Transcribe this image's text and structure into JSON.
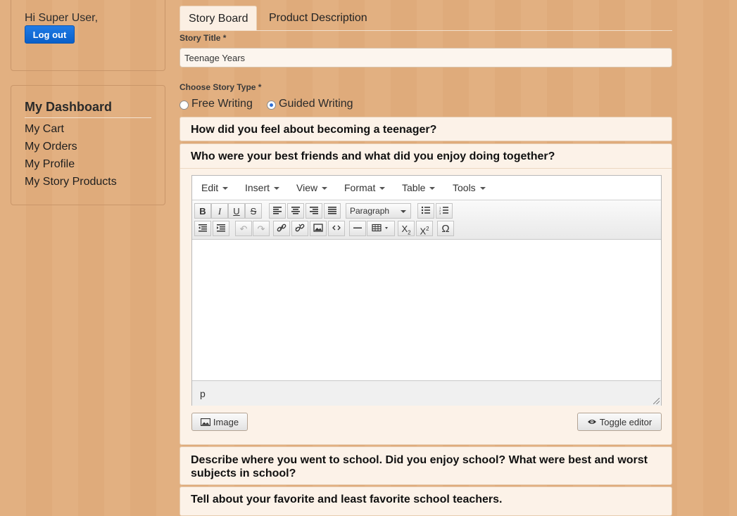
{
  "user_panel": {
    "greeting": "Hi Super User,",
    "logout_label": "Log out"
  },
  "dashboard": {
    "title": "My Dashboard",
    "links": [
      "My Cart",
      "My Orders",
      "My Profile",
      "My Story Products"
    ]
  },
  "tabs": [
    {
      "label": "Story Board",
      "active": true
    },
    {
      "label": "Product Description",
      "active": false
    }
  ],
  "form": {
    "story_title_label": "Story Title *",
    "story_title_value": "Teenage Years",
    "story_type_label": "Choose Story Type *",
    "story_types": [
      {
        "label": "Free Writing",
        "checked": false
      },
      {
        "label": "Guided Writing",
        "checked": true
      }
    ]
  },
  "questions": [
    "How did you feel about becoming a teenager?",
    "Who were your best friends and what did you enjoy doing together?",
    "Describe where you went to school. Did you enjoy school? What were best and worst subjects in school?",
    "Tell about your favorite and least favorite school teachers."
  ],
  "editor": {
    "menus": [
      "Edit",
      "Insert",
      "View",
      "Format",
      "Table",
      "Tools"
    ],
    "format_value": "Paragraph",
    "status_path": "p",
    "toolbar_icons": [
      "bold-icon",
      "italic-icon",
      "underline-icon",
      "strikethrough-icon",
      "align-left-icon",
      "align-center-icon",
      "align-right-icon",
      "align-justify-icon",
      "bullet-list-icon",
      "numbered-list-icon",
      "outdent-icon",
      "indent-icon",
      "undo-icon",
      "redo-icon",
      "link-icon",
      "unlink-icon",
      "image-icon",
      "code-icon",
      "horizontal-rule-icon",
      "table-icon",
      "subscript-icon",
      "superscript-icon",
      "special-char-icon"
    ]
  },
  "buttons": {
    "image_label": "Image",
    "toggle_label": "Toggle editor"
  },
  "colors": {
    "logout_button": "#0a5fc8",
    "radio_dot": "#2e6fd6"
  }
}
